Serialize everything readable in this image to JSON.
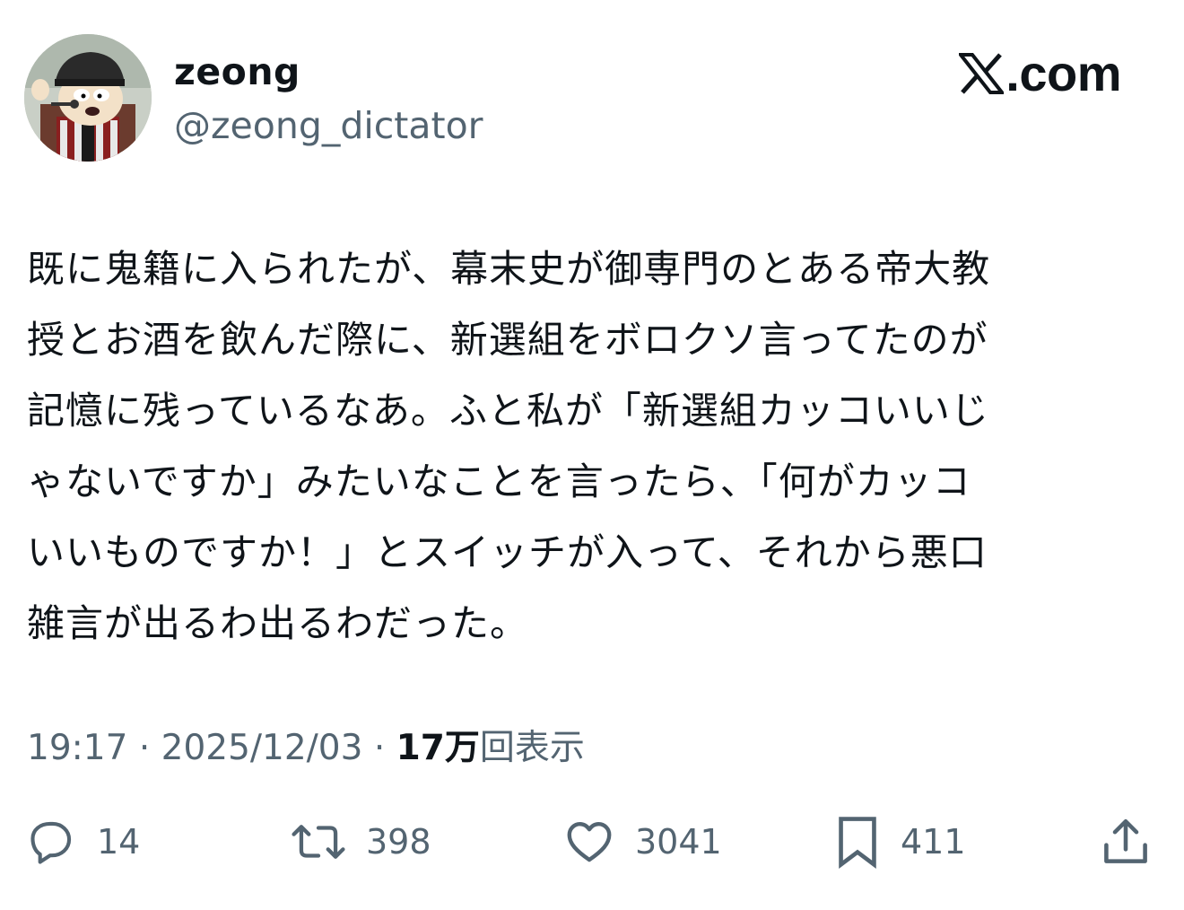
{
  "brand": {
    "logo_text": "𝕏",
    "domain_text": ".com"
  },
  "author": {
    "display_name": "zeong",
    "handle": "@zeong_dictator"
  },
  "tweet": {
    "text": "既に鬼籍に入られたが、幕末史が御専門のとある帝大教\n授とお酒を飲んだ際に、新選組をボロクソ言ってたのが\n記憶に残っているなあ。ふと私が「新選組カッコいいじ\nゃないですか」みたいなことを言ったら、「何がカッコ\nいいものですか！」とスイッチが入って、それから悪口\n雑言が出るわ出るわだった。"
  },
  "meta": {
    "time": "19:17",
    "separator": "·",
    "date": "2025/12/03",
    "views_count": "17万",
    "views_label": "回表示"
  },
  "actions": {
    "reply_count": "14",
    "repost_count": "398",
    "like_count": "3041",
    "bookmark_count": "411"
  },
  "icons": {
    "reply": "speech-bubble-icon",
    "repost": "repost-arrows-icon",
    "like": "heart-icon",
    "bookmark": "bookmark-icon",
    "share": "share-upload-icon"
  },
  "colors": {
    "text_primary": "#0f1419",
    "text_secondary": "#536471",
    "background": "#ffffff"
  }
}
